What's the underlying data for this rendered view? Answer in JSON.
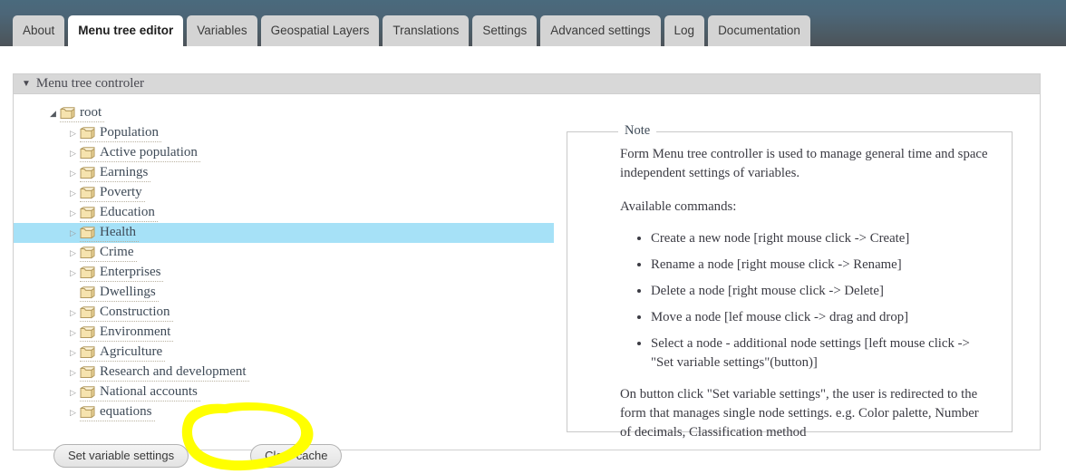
{
  "header": {
    "tabs": [
      {
        "label": "About",
        "active": false
      },
      {
        "label": "Menu tree editor",
        "active": true
      },
      {
        "label": "Variables",
        "active": false
      },
      {
        "label": "Geospatial Layers",
        "active": false
      },
      {
        "label": "Translations",
        "active": false
      },
      {
        "label": "Settings",
        "active": false
      },
      {
        "label": "Advanced settings",
        "active": false
      },
      {
        "label": "Log",
        "active": false
      },
      {
        "label": "Documentation",
        "active": false
      }
    ]
  },
  "panel": {
    "title": "Menu tree controler",
    "caret_icon": "triangle-down-icon",
    "collapse_caret": "▼"
  },
  "tree": {
    "expanded_arrow": "◢",
    "collapsed_arrow": "▷",
    "folder_icon": "folder-icon",
    "nodes": [
      {
        "label": "root",
        "depth": 0,
        "state": "expanded",
        "selected": false
      },
      {
        "label": "Population",
        "depth": 1,
        "state": "collapsed",
        "selected": false
      },
      {
        "label": "Active population",
        "depth": 1,
        "state": "collapsed",
        "selected": false
      },
      {
        "label": "Earnings",
        "depth": 1,
        "state": "collapsed",
        "selected": false
      },
      {
        "label": "Poverty",
        "depth": 1,
        "state": "collapsed",
        "selected": false
      },
      {
        "label": "Education",
        "depth": 1,
        "state": "collapsed",
        "selected": false
      },
      {
        "label": "Health",
        "depth": 1,
        "state": "collapsed",
        "selected": true
      },
      {
        "label": "Crime",
        "depth": 1,
        "state": "collapsed",
        "selected": false
      },
      {
        "label": "Enterprises",
        "depth": 1,
        "state": "collapsed",
        "selected": false
      },
      {
        "label": "Dwellings",
        "depth": 1,
        "state": "leaf",
        "selected": false
      },
      {
        "label": "Construction",
        "depth": 1,
        "state": "collapsed",
        "selected": false
      },
      {
        "label": "Environment",
        "depth": 1,
        "state": "collapsed",
        "selected": false
      },
      {
        "label": "Agriculture",
        "depth": 1,
        "state": "collapsed",
        "selected": false
      },
      {
        "label": "Research and development",
        "depth": 1,
        "state": "collapsed",
        "selected": false
      },
      {
        "label": "National accounts",
        "depth": 1,
        "state": "collapsed",
        "selected": false
      },
      {
        "label": "equations",
        "depth": 1,
        "state": "collapsed",
        "selected": false
      }
    ]
  },
  "buttons": {
    "set_variable_settings": "Set variable settings",
    "clear_cache": "Clear cache"
  },
  "note": {
    "legend": "Note",
    "intro": "Form Menu tree controller is used to manage general time and space independent settings of variables.",
    "commands_label": "Available commands:",
    "commands": [
      "Create a new node [right mouse click -> Create]",
      "Rename a node [right mouse click -> Rename]",
      "Delete a node [right mouse click -> Delete]",
      "Move a node [lef mouse click -> drag and drop]",
      "Select a node - additional node settings [left mouse click -> \"Set variable settings\"(button)]"
    ],
    "outro": "On button click \"Set variable settings\", the user is redirected to the form that manages single node settings. e.g. Color palette, Number of decimals, Classification method"
  },
  "annotation": {
    "type": "highlighter-ellipse",
    "color": "#FFFF00",
    "target": "Clear cache"
  },
  "colors": {
    "header_top": "#4a6a7d",
    "header_bottom": "#4d5359",
    "tab_inactive": "#d4d4d4",
    "tab_active": "#ffffff",
    "panel_header": "#d8d8d8",
    "selection": "#a6e1f7",
    "annotation": "#FFFF00"
  }
}
